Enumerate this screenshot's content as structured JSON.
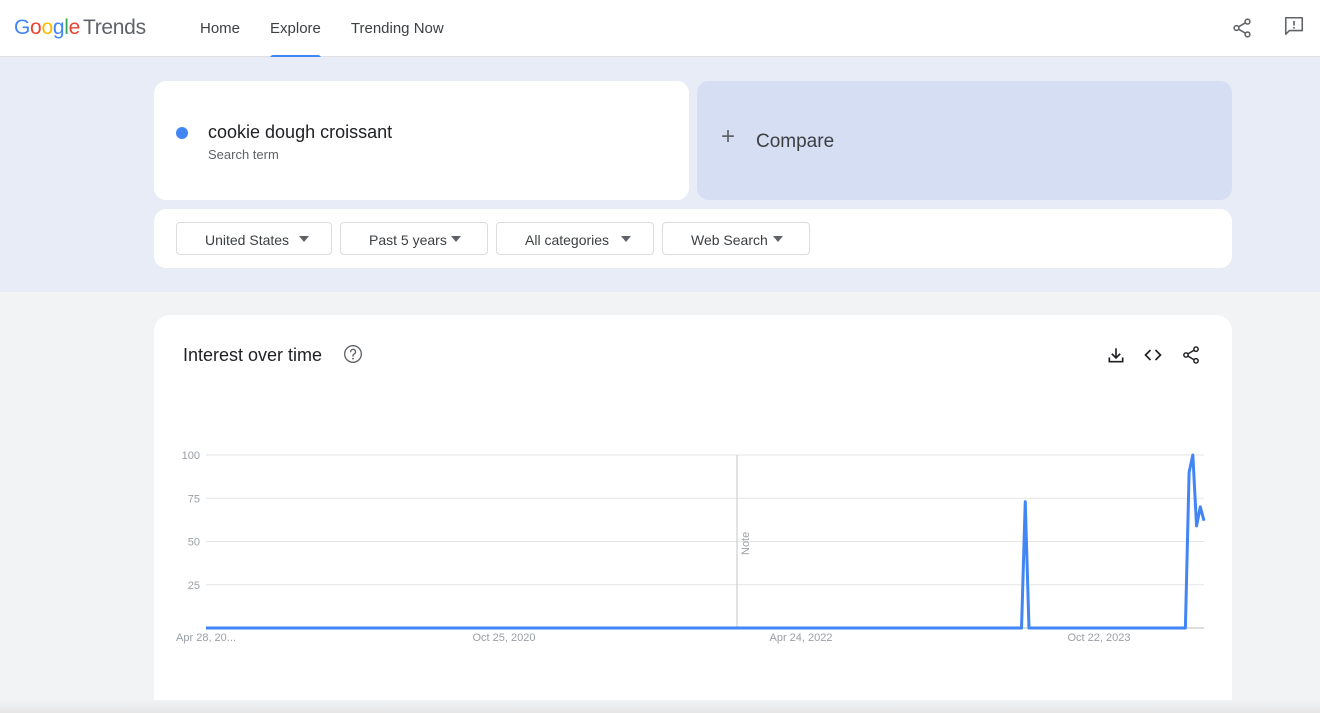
{
  "header": {
    "logo": {
      "g": "G",
      "o1": "o",
      "o2": "o",
      "g2": "g",
      "l": "l",
      "e": "e",
      "trends": "Trends"
    },
    "nav": [
      {
        "label": "Home",
        "active": false
      },
      {
        "label": "Explore",
        "active": true
      },
      {
        "label": "Trending Now",
        "active": false
      }
    ],
    "icons": [
      "share-icon",
      "feedback-icon"
    ]
  },
  "search": {
    "term": "cookie dough croissant",
    "term_subtitle": "Search term",
    "term_color": "#4285f4",
    "compare_label": "Compare",
    "compare_icon": "plus-icon"
  },
  "filters": [
    {
      "label": "United States"
    },
    {
      "label": "Past 5 years"
    },
    {
      "label": "All categories"
    },
    {
      "label": "Web Search"
    }
  ],
  "interest_card": {
    "title": "Interest over time",
    "icons": [
      "help-icon",
      "download-icon",
      "embed-icon",
      "share-icon"
    ]
  },
  "chart_data": {
    "type": "line",
    "title": "Interest over time",
    "xlabel": "",
    "ylabel": "",
    "ylim": [
      0,
      100
    ],
    "yticks": [
      25,
      50,
      75,
      100
    ],
    "y_tick_labels": [
      "25",
      "50",
      "75",
      "100"
    ],
    "x_tick_labels": [
      "Apr 28, 20...",
      "Oct 25, 2020",
      "Apr 24, 2022",
      "Oct 22, 2023"
    ],
    "note_label": "Note",
    "grid": true,
    "series": [
      {
        "color": "#4285f4",
        "values": [
          0,
          0,
          0,
          0,
          0,
          0,
          0,
          0,
          0,
          0,
          0,
          0,
          0,
          0,
          0,
          0,
          0,
          0,
          0,
          0,
          0,
          0,
          0,
          0,
          0,
          0,
          0,
          0,
          0,
          0,
          0,
          0,
          0,
          0,
          0,
          0,
          0,
          0,
          0,
          0,
          0,
          0,
          0,
          0,
          0,
          0,
          0,
          0,
          0,
          0,
          0,
          0,
          0,
          0,
          0,
          0,
          0,
          0,
          0,
          0,
          0,
          0,
          0,
          0,
          0,
          0,
          0,
          0,
          0,
          0,
          0,
          0,
          0,
          0,
          0,
          0,
          0,
          0,
          0,
          0,
          0,
          0,
          0,
          0,
          0,
          0,
          0,
          0,
          0,
          0,
          0,
          0,
          0,
          0,
          0,
          0,
          0,
          0,
          0,
          0,
          0,
          0,
          0,
          0,
          0,
          0,
          0,
          0,
          0,
          0,
          0,
          0,
          0,
          0,
          0,
          0,
          0,
          0,
          0,
          0,
          0,
          0,
          0,
          0,
          0,
          0,
          0,
          0,
          0,
          0,
          0,
          0,
          0,
          0,
          0,
          0,
          0,
          0,
          0,
          0,
          0,
          0,
          0,
          0,
          0,
          0,
          0,
          0,
          0,
          0,
          0,
          0,
          0,
          0,
          0,
          0,
          0,
          0,
          0,
          0,
          0,
          0,
          0,
          0,
          0,
          0,
          0,
          0,
          0,
          0,
          0,
          0,
          0,
          0,
          0,
          0,
          0,
          0,
          0,
          0,
          0,
          0,
          0,
          0,
          0,
          0,
          0,
          0,
          0,
          0,
          0,
          0,
          0,
          0,
          0,
          0,
          0,
          0,
          0,
          0,
          0,
          0,
          0,
          0,
          0,
          0,
          0,
          0,
          0,
          0,
          0,
          0,
          0,
          0,
          0,
          0,
          0,
          0,
          0,
          0,
          73,
          0,
          0,
          0,
          0,
          0,
          0,
          0,
          0,
          0,
          0,
          0,
          0,
          0,
          0,
          0,
          0,
          0,
          0,
          0,
          0,
          0,
          0,
          0,
          0,
          0,
          0,
          0,
          0,
          0,
          0,
          0,
          0,
          0,
          0,
          0,
          0,
          0,
          0,
          0,
          0,
          0,
          0,
          0,
          90,
          100,
          59,
          70,
          62
        ]
      }
    ]
  }
}
